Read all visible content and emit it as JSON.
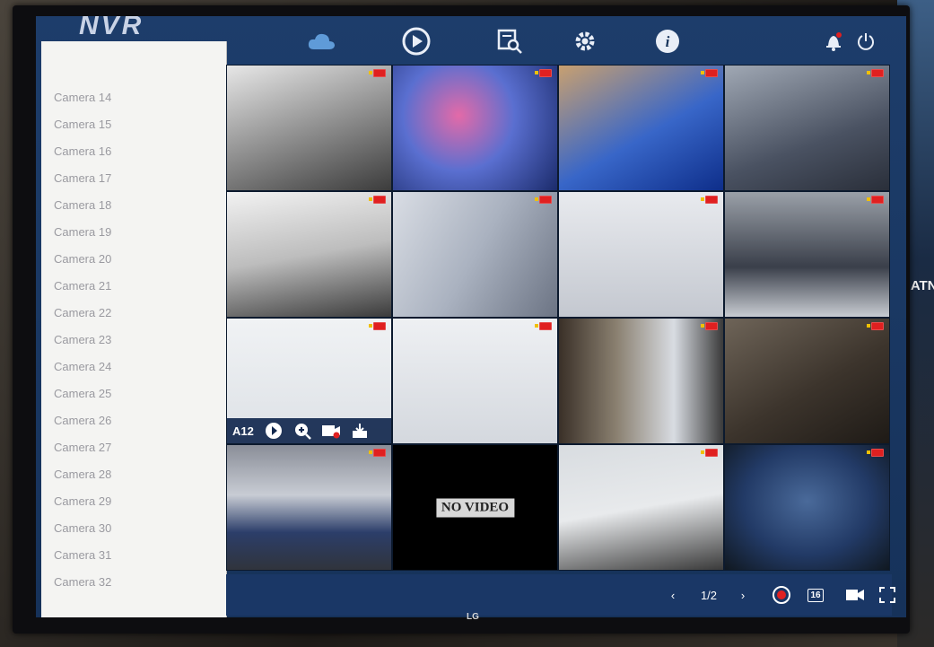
{
  "app": {
    "brand": "NVR"
  },
  "topbar": {
    "icons": [
      "cloud-icon",
      "live-view-icon",
      "search-playback-icon",
      "settings-icon",
      "info-icon",
      "alarm-bell-icon",
      "power-icon"
    ]
  },
  "sidebar": {
    "items": [
      "Camera 14",
      "Camera 15",
      "Camera 16",
      "Camera 17",
      "Camera 18",
      "Camera 19",
      "Camera 20",
      "Camera 21",
      "Camera 22",
      "Camera 23",
      "Camera 24",
      "Camera 25",
      "Camera 26",
      "Camera 27",
      "Camera 28",
      "Camera 29",
      "Camera 30",
      "Camera 31",
      "Camera 32"
    ]
  },
  "grid": {
    "tiles": [
      {
        "scene": "classroom"
      },
      {
        "scene": "people-color"
      },
      {
        "scene": "classroom-blue"
      },
      {
        "scene": "dim-room"
      },
      {
        "scene": "lab"
      },
      {
        "scene": "corridor"
      },
      {
        "scene": "bright-floor"
      },
      {
        "scene": "seating-dim"
      },
      {
        "scene": "bright-washed",
        "toolbar": true
      },
      {
        "scene": "bright-washed"
      },
      {
        "scene": "hallway"
      },
      {
        "scene": "dark-room"
      },
      {
        "scene": "parking"
      },
      {
        "scene": "no-video"
      },
      {
        "scene": "office"
      },
      {
        "scene": "fisheye"
      }
    ],
    "no_video_text": "NO VIDEO",
    "selected_tile_toolbar": {
      "label": "A12",
      "buttons": [
        "playback-icon",
        "zoom-icon",
        "record-icon",
        "snapshot-icon"
      ]
    }
  },
  "bottombar": {
    "prev": "‹",
    "page": "1/2",
    "next": "›",
    "layout_badge": "16"
  },
  "monitor": {
    "logo": "LG"
  },
  "background": {
    "poster_text": "HATN"
  }
}
